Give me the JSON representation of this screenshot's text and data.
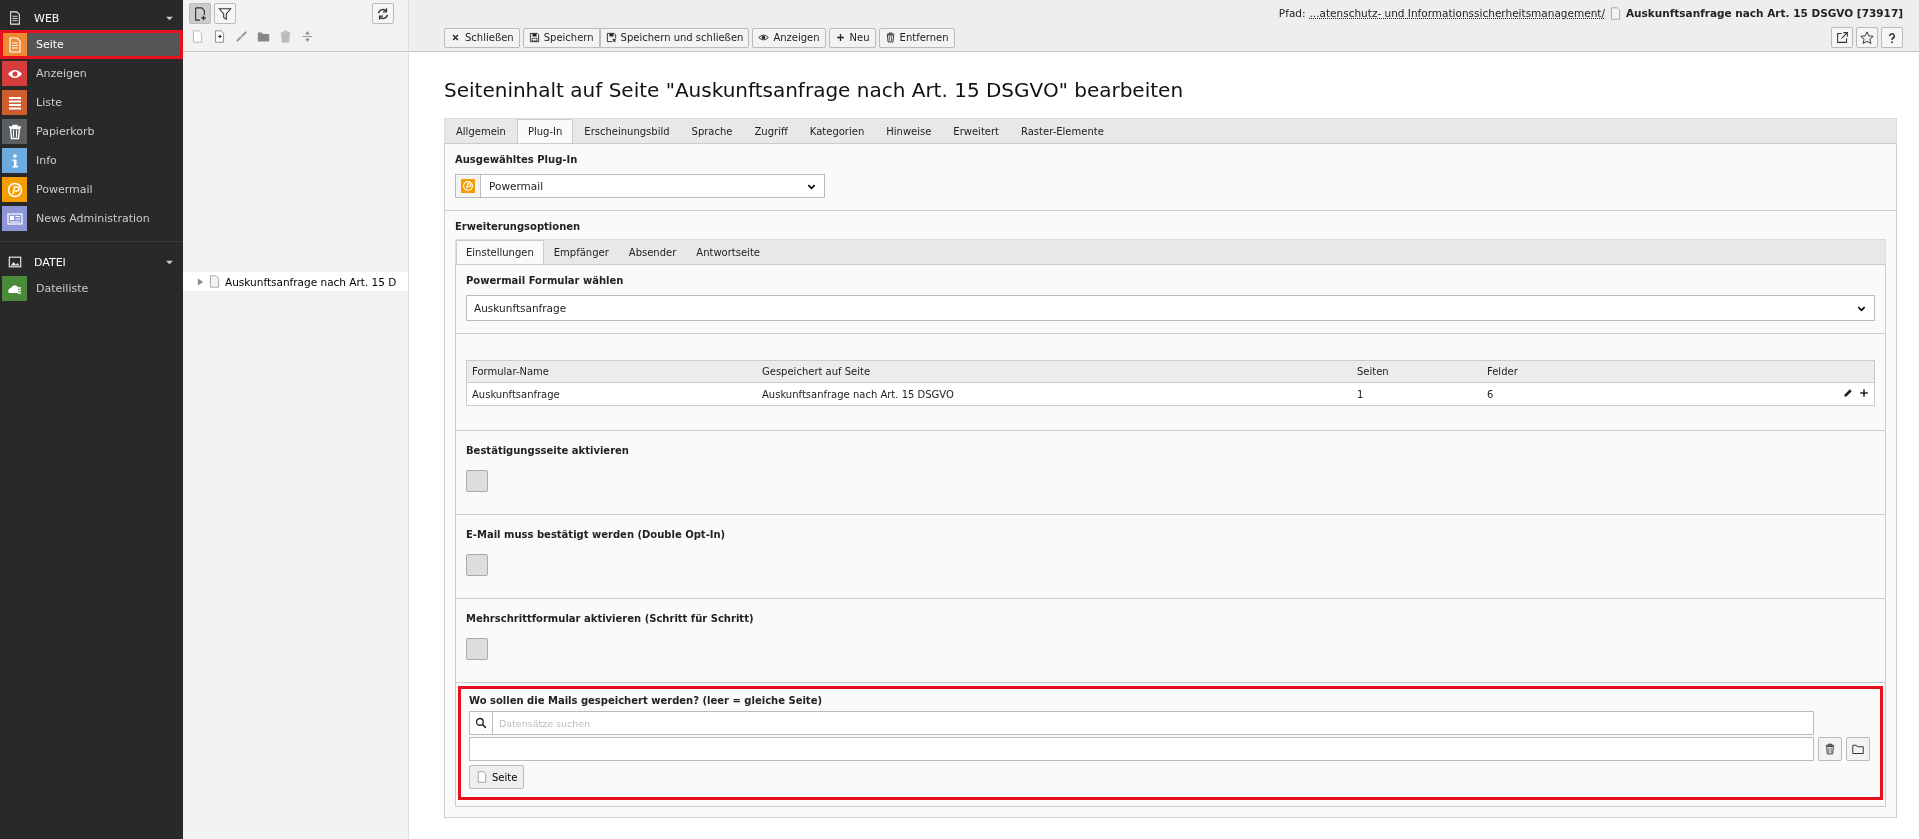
{
  "sidebar": {
    "groups": [
      {
        "title": "WEB",
        "kind": "page",
        "expanded": true,
        "items": [
          {
            "label": "Seite",
            "kind": "page",
            "color": "#ee8a33",
            "selected": true,
            "highlighted": true
          },
          {
            "label": "Anzeigen",
            "kind": "eye",
            "color": "#d63d3d",
            "selected": false,
            "highlighted": false
          },
          {
            "label": "Liste",
            "kind": "list",
            "color": "#cd5d2d",
            "selected": false,
            "highlighted": false
          },
          {
            "label": "Papierkorb",
            "kind": "trash",
            "color": "#5c5f62",
            "selected": false,
            "highlighted": false
          },
          {
            "label": "Info",
            "kind": "info",
            "color": "#6daae0",
            "selected": false,
            "highlighted": false
          },
          {
            "label": "Powermail",
            "kind": "at",
            "color": "#f59c00",
            "selected": false,
            "highlighted": false
          },
          {
            "label": "News Administration",
            "kind": "news",
            "color": "#8d96d8",
            "selected": false,
            "highlighted": false
          }
        ]
      },
      {
        "title": "DATEI",
        "kind": "image",
        "expanded": true,
        "items": [
          {
            "label": "Dateiliste",
            "kind": "cloud",
            "color": "#4a8a3a",
            "selected": false,
            "highlighted": false
          }
        ]
      }
    ]
  },
  "tree": {
    "nodes": [
      {
        "label": "Auskunftsanfrage nach Art. 15 D",
        "expanded": false
      }
    ]
  },
  "path": {
    "label": "Pfad:",
    "link": "...atenschutz- und Informationssicherheitsmanagement/",
    "page": "Auskunftsanfrage nach Art. 15 DSGVO [73917]"
  },
  "toolbar": {
    "buttons": [
      {
        "label": "Schließen",
        "kind": "close"
      },
      {
        "label": "Speichern",
        "kind": "save"
      },
      {
        "label": "Speichern und schließen",
        "kind": "save-close"
      },
      {
        "label": "Anzeigen",
        "kind": "view"
      },
      {
        "label": "Neu",
        "kind": "new"
      },
      {
        "label": "Entfernen",
        "kind": "delete"
      }
    ]
  },
  "title": "Seiteninhalt auf Seite \"Auskunftsanfrage nach Art. 15 DSGVO\" bearbeiten",
  "tabs": [
    {
      "label": "Allgemein",
      "selected": false
    },
    {
      "label": "Plug-In",
      "selected": true
    },
    {
      "label": "Erscheinungsbild",
      "selected": false
    },
    {
      "label": "Sprache",
      "selected": false
    },
    {
      "label": "Zugriff",
      "selected": false
    },
    {
      "label": "Kategorien",
      "selected": false
    },
    {
      "label": "Hinweise",
      "selected": false
    },
    {
      "label": "Erweitert",
      "selected": false
    },
    {
      "label": "Raster-Elemente",
      "selected": false
    }
  ],
  "plugin": {
    "label": "Ausgewähltes Plug-In",
    "value": "Powermail"
  },
  "extension": {
    "title": "Erweiterungsoptionen",
    "tabs": [
      {
        "label": "Einstellungen",
        "selected": true
      },
      {
        "label": "Empfänger",
        "selected": false
      },
      {
        "label": "Absender",
        "selected": false
      },
      {
        "label": "Antwortseite",
        "selected": false
      }
    ],
    "form_select": {
      "label": "Powermail Formular wählen",
      "value": "Auskunftsanfrage"
    },
    "table": {
      "columns": [
        "Formular-Name",
        "Gespeichert auf Seite",
        "Seiten",
        "Felder"
      ],
      "rows": [
        [
          "Auskunftsanfrage",
          "Auskunftsanfrage nach Art. 15 DSGVO",
          "1",
          "6"
        ]
      ]
    },
    "checkboxes": [
      {
        "label": "Bestätigungsseite aktivieren",
        "checked": false
      },
      {
        "label": "E-Mail muss bestätigt werden (Double Opt-In)",
        "checked": false
      },
      {
        "label": "Mehrschrittformular aktivieren (Schritt für Schritt)",
        "checked": false
      }
    ],
    "storage": {
      "label": "Wo sollen die Mails gespeichert werden? (leer = gleiche Seite)",
      "placeholder": "Datensätze suchen",
      "button": "Seite",
      "highlighted": true
    }
  }
}
